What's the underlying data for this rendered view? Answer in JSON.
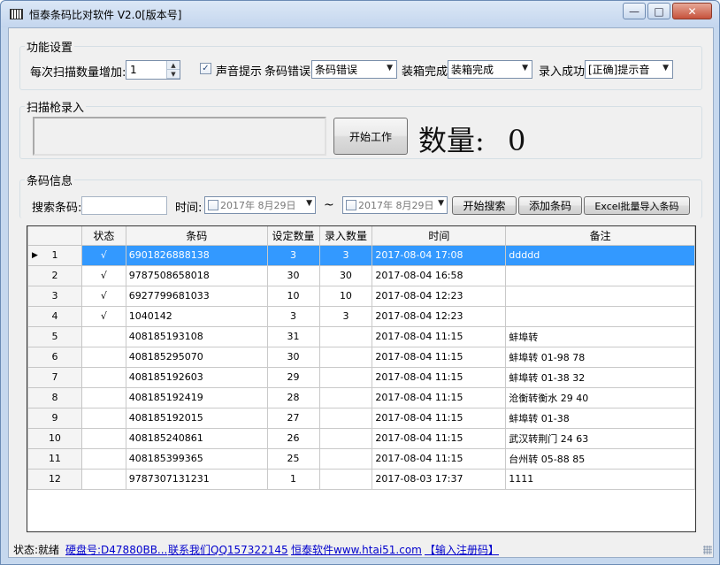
{
  "window": {
    "title": "恒泰条码比对软件 V2.0[版本号]",
    "minimize_glyph": "—",
    "maximize_glyph": "□",
    "close_glyph": "✕"
  },
  "settings": {
    "group_label": "功能设置",
    "increment_label": "每次扫描数量增加:",
    "increment_value": "1",
    "sound_checked": true,
    "sound_label": "声音提示",
    "barcode_error_label": "条码错误",
    "barcode_error_value": "条码错误",
    "box_done_label": "装箱完成",
    "box_done_value": "装箱完成",
    "entry_success_label": "录入成功",
    "entry_success_value": "[正确]提示音"
  },
  "scanner": {
    "group_label": "扫描枪录入",
    "start_button": "开始工作",
    "quantity_label": "数量:",
    "quantity_value": "0"
  },
  "search": {
    "group_label": "条码信息",
    "barcode_label": "搜索条码:",
    "barcode_value": "",
    "time_label": "时间:",
    "date_from": "2017年  8月29日",
    "tilde": "~",
    "date_to": "2017年  8月29日",
    "search_button": "开始搜索",
    "add_button": "添加条码",
    "import_button": "Excel批量导入条码"
  },
  "grid": {
    "columns": [
      "状态",
      "条码",
      "设定数量",
      "录入数量",
      "时间",
      "备注"
    ],
    "rows": [
      {
        "n": "1",
        "status": "√",
        "barcode": "6901826888138",
        "set_qty": "3",
        "in_qty": "3",
        "time": "2017-08-04 17:08",
        "note": "ddddd",
        "selected": true
      },
      {
        "n": "2",
        "status": "√",
        "barcode": "9787508658018",
        "set_qty": "30",
        "in_qty": "30",
        "time": "2017-08-04 16:58",
        "note": ""
      },
      {
        "n": "3",
        "status": "√",
        "barcode": "6927799681033",
        "set_qty": "10",
        "in_qty": "10",
        "time": "2017-08-04 12:23",
        "note": ""
      },
      {
        "n": "4",
        "status": "√",
        "barcode": "1040142",
        "set_qty": "3",
        "in_qty": "3",
        "time": "2017-08-04 12:23",
        "note": ""
      },
      {
        "n": "5",
        "status": "",
        "barcode": "408185193108",
        "set_qty": "31",
        "in_qty": "",
        "time": "2017-08-04 11:15",
        "note": "蚌埠转"
      },
      {
        "n": "6",
        "status": "",
        "barcode": "408185295070",
        "set_qty": "30",
        "in_qty": "",
        "time": "2017-08-04 11:15",
        "note": "蚌埠转 01-98 78"
      },
      {
        "n": "7",
        "status": "",
        "barcode": "408185192603",
        "set_qty": "29",
        "in_qty": "",
        "time": "2017-08-04 11:15",
        "note": "蚌埠转 01-38 32"
      },
      {
        "n": "8",
        "status": "",
        "barcode": "408185192419",
        "set_qty": "28",
        "in_qty": "",
        "time": "2017-08-04 11:15",
        "note": "沧衡转衡水 29 40"
      },
      {
        "n": "9",
        "status": "",
        "barcode": "408185192015",
        "set_qty": "27",
        "in_qty": "",
        "time": "2017-08-04 11:15",
        "note": "蚌埠转 01-38"
      },
      {
        "n": "10",
        "status": "",
        "barcode": "408185240861",
        "set_qty": "26",
        "in_qty": "",
        "time": "2017-08-04 11:15",
        "note": "武汉转荆门 24 63"
      },
      {
        "n": "11",
        "status": "",
        "barcode": "408185399365",
        "set_qty": "25",
        "in_qty": "",
        "time": "2017-08-04 11:15",
        "note": "台州转 05-88 85"
      },
      {
        "n": "12",
        "status": "",
        "barcode": "9787307131231",
        "set_qty": "1",
        "in_qty": "",
        "time": "2017-08-03 17:37",
        "note": "1111"
      }
    ]
  },
  "statusbar": {
    "status": "状态:就绪",
    "disk": "硬盘号:D47880BB...",
    "contact": "联系我们QQ157322145",
    "website": "恒泰软件www.htai51.com",
    "register": "【输入注册码】"
  },
  "icons": {
    "app": "barcode-icon",
    "spin_up": "▲",
    "spin_down": "▼",
    "dropdown": "▼",
    "row_pointer": "▶",
    "check": "✓"
  }
}
